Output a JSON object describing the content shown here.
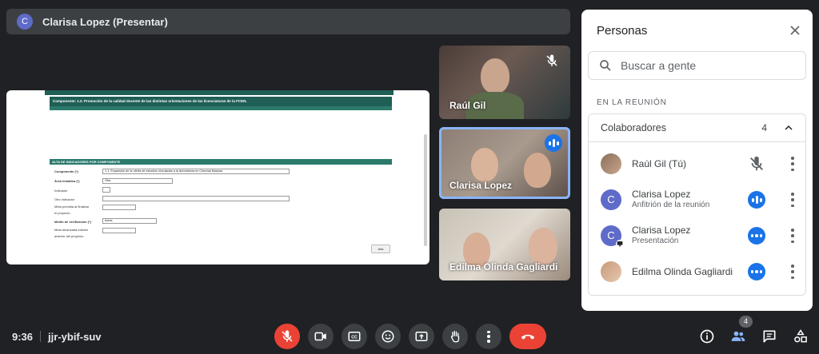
{
  "presenter": {
    "initial": "C",
    "title": "Clarisa Lopez (Presentar)"
  },
  "shared_screen": {
    "component_title": "Componente: 1.2. Promoción de la calidad docente de las distintas orientaciones de las licenciaturas de la FCEN.",
    "section_title": "ALTA DE INDICADORES POR COMPONENTE",
    "fields": {
      "componente_label": "Componente (*)",
      "componente_value": "1.1. Expansión de la oferta de estudios vinculadas a la licenciatura en Ciencias Básicas",
      "area_label": "Área temática (*)",
      "area_value": "Otra",
      "indicador_label": "Indicador",
      "otro_label": "Otro indicador",
      "meta_label_1": "Meta prevista al finalizar",
      "meta_label_2": "el proyecto",
      "medio_label": "Medio de verificación (*)",
      "medio_value": "Actas",
      "alcanzada_label_1": "Meta alcanzada edición",
      "alcanzada_label_2": "anterior del proyecto"
    },
    "add_button": "Alta"
  },
  "tiles": [
    {
      "name": "Raúl Gil",
      "muted": true
    },
    {
      "name": "Clarisa Lopez",
      "speaking": true
    },
    {
      "name": "Edilma Olinda Gagliardi"
    }
  ],
  "panel": {
    "title": "Personas",
    "search_placeholder": "Buscar a gente",
    "section_label": "EN LA REUNIÓN",
    "group_name": "Colaboradores",
    "group_count": "4",
    "people": [
      {
        "name": "Raúl Gil (Tú)",
        "sub": "",
        "status": "muted"
      },
      {
        "initial": "C",
        "name": "Clarisa Lopez",
        "sub": "Anfitrión de la reunión",
        "status": "speaking"
      },
      {
        "initial": "C",
        "name": "Clarisa Lopez",
        "sub": "Presentación",
        "status": "more"
      },
      {
        "name": "Edilma Olinda Gagliardi",
        "sub": "",
        "status": "more"
      }
    ]
  },
  "bottom": {
    "time": "9:36",
    "meeting_code": "jjr-ybif-suv",
    "people_count": "4"
  },
  "colors": {
    "accent": "#1a73e8",
    "end_call": "#ea4335",
    "background": "#202124"
  }
}
